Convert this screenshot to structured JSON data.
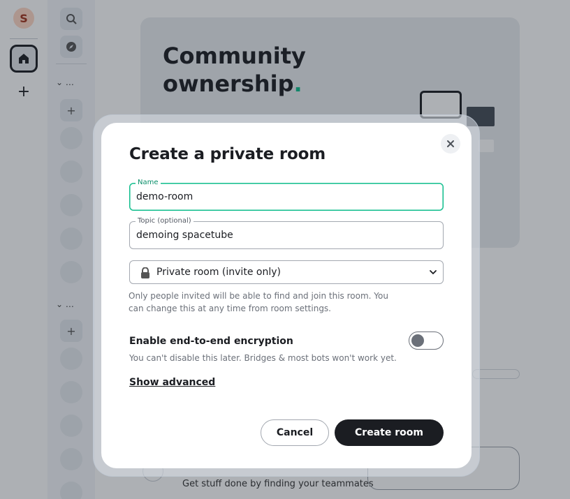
{
  "sidebar": {
    "space_avatar_letter": "S",
    "section_labels": [
      "…",
      "…"
    ]
  },
  "hero": {
    "title_line1": "Community",
    "title_line2": "ownership",
    "title_dot": "."
  },
  "main": {
    "footer_text": "Get stuff done by finding your teammates"
  },
  "dialog": {
    "title": "Create a private room",
    "close_icon": "close-icon",
    "name": {
      "label": "Name",
      "value": "demo-room"
    },
    "topic": {
      "label": "Topic (optional)",
      "value": "demoing spacetube"
    },
    "visibility": {
      "selected": "Private room (invite only)",
      "icon": "lock-icon"
    },
    "help_text": "Only people invited will be able to find and join this room. You can change this at any time from room settings.",
    "encryption": {
      "label": "Enable end-to-end encryption",
      "sub": "You can't disable this later. Bridges & most bots won't work yet.",
      "enabled": false
    },
    "show_advanced": "Show advanced",
    "cancel_label": "Cancel",
    "create_label": "Create room"
  },
  "colors": {
    "accent": "#0dbd8b",
    "primary_button": "#1b1d22",
    "overlay": "#1b2430"
  }
}
